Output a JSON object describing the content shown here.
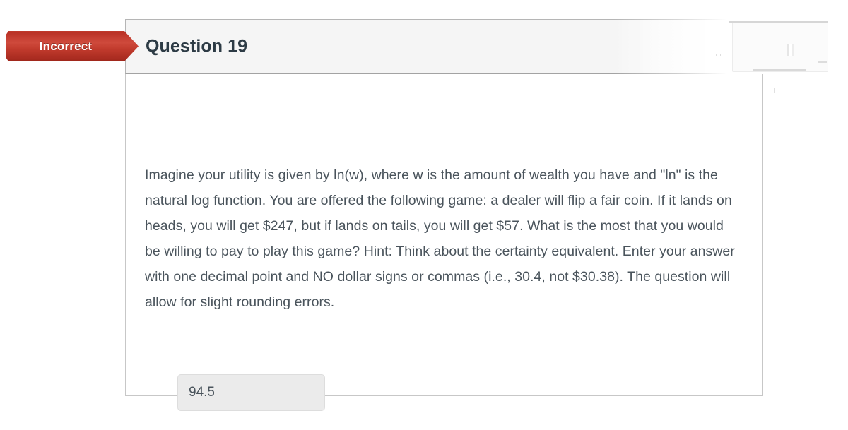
{
  "status": {
    "label": "Incorrect",
    "color": "#c0392b"
  },
  "question": {
    "title": "Question 19",
    "text": "Imagine your utility is given by ln(w), where w is the amount of wealth you have and \"ln\" is the natural log function.  You are offered the following game: a dealer will flip a fair coin.  If it lands on heads, you will get $247, but if lands on tails, you will get $57.  What is the most that you would be willing to pay to play this game?  Hint: Think about the certainty equivalent. Enter your answer with one decimal point and NO dollar signs or commas (i.e., 30.4, not $30.38). The question will allow for slight rounding errors.",
    "answer_value": "94.5",
    "answer_placeholder": ""
  },
  "theme": {
    "header_background": "#f5f5f5",
    "title_color": "#2d3b45",
    "body_text_color": "#4a545c",
    "input_background": "#ebebeb"
  }
}
